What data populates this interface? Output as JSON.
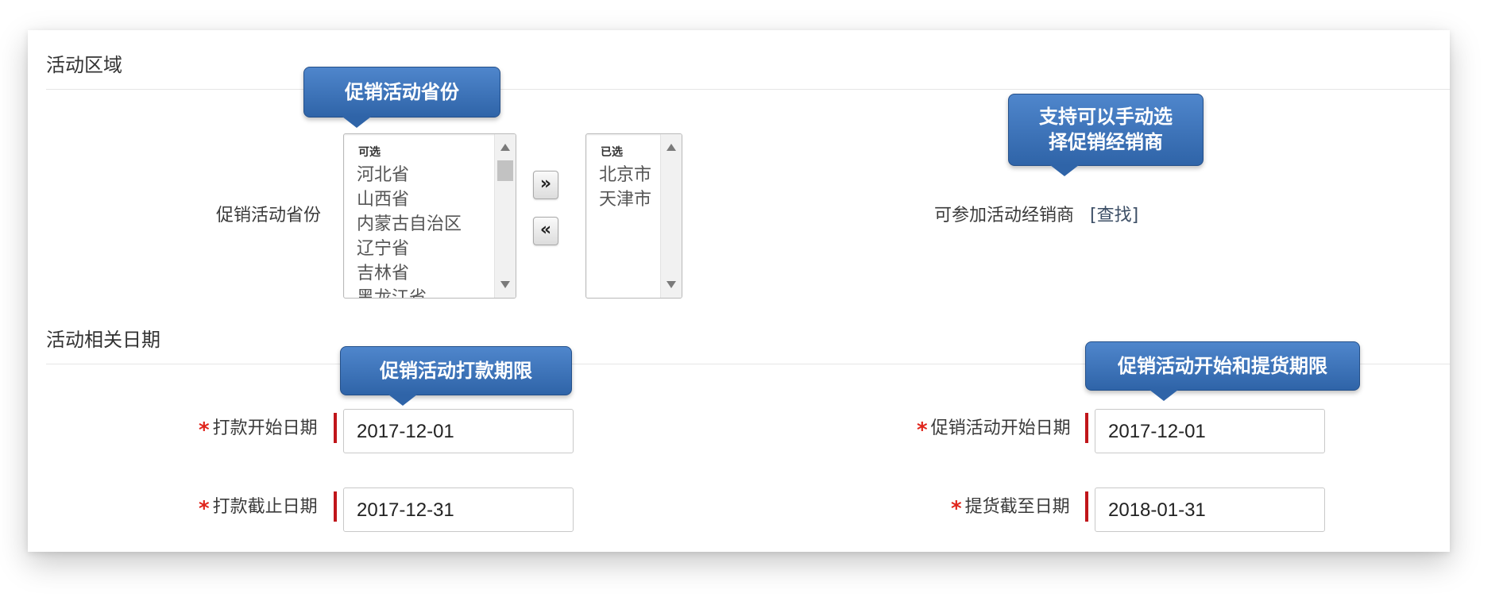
{
  "sections": {
    "area_title": "活动区域",
    "date_title": "活动相关日期"
  },
  "province": {
    "label": "促销活动省份",
    "available_header": "可选",
    "available_items": [
      "河北省",
      "山西省",
      "内蒙古自治区",
      "辽宁省",
      "吉林省",
      "黑龙江省"
    ],
    "selected_header": "已选",
    "selected_items": [
      "北京市",
      "天津市"
    ],
    "add_label": "»",
    "remove_label": "«"
  },
  "dealers": {
    "label": "可参加活动经销商",
    "search_link": "[查找]"
  },
  "dates": {
    "required_mark": "*",
    "payment_start_label": "打款开始日期",
    "payment_start_value": "2017-12-01",
    "payment_end_label": "打款截止日期",
    "payment_end_value": "2017-12-31",
    "promo_start_label": "促销活动开始日期",
    "promo_start_value": "2017-12-01",
    "delivery_end_label": "提货截至日期",
    "delivery_end_value": "2018-01-31"
  },
  "callouts": {
    "province": "促销活动省份",
    "dealers_line1": "支持可以手动选",
    "dealers_line2": "择促销经销商",
    "payment": "促销活动打款期限",
    "promo": "促销活动开始和提货期限"
  },
  "colors": {
    "callout_blue": "#3a72bb",
    "required_red": "#e0241b",
    "marker_red": "#c0151a"
  }
}
